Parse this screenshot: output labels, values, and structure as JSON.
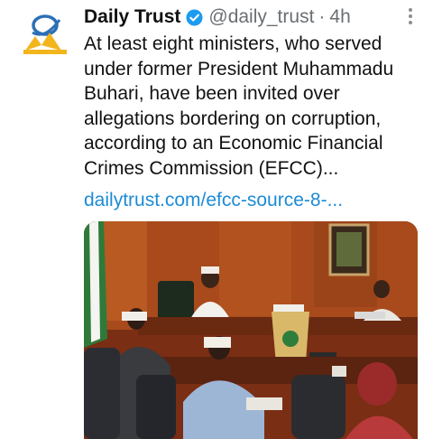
{
  "tweet": {
    "author_name": "Daily Trust",
    "handle": "@daily_trust",
    "separator": "·",
    "time": "4h",
    "text_lines": [
      "At least eight ministers, who served",
      "under former President Muhammadu",
      "Buhari, have been invited over",
      "allegations bordering on corruption,",
      "according to an Economic Financial",
      "Crimes Commission (EFCC)..."
    ],
    "link": "dailytrust.com/efcc-source-8-...",
    "icons": {
      "avatar": "daily-trust-logo",
      "verified": "verified-badge-icon",
      "more": "more-options-icon"
    },
    "colors": {
      "link": "#1d8bd6",
      "verified": "#1d9bf0",
      "logo_blue": "#2c6fb5",
      "logo_yellow": "#f2b51c"
    }
  }
}
